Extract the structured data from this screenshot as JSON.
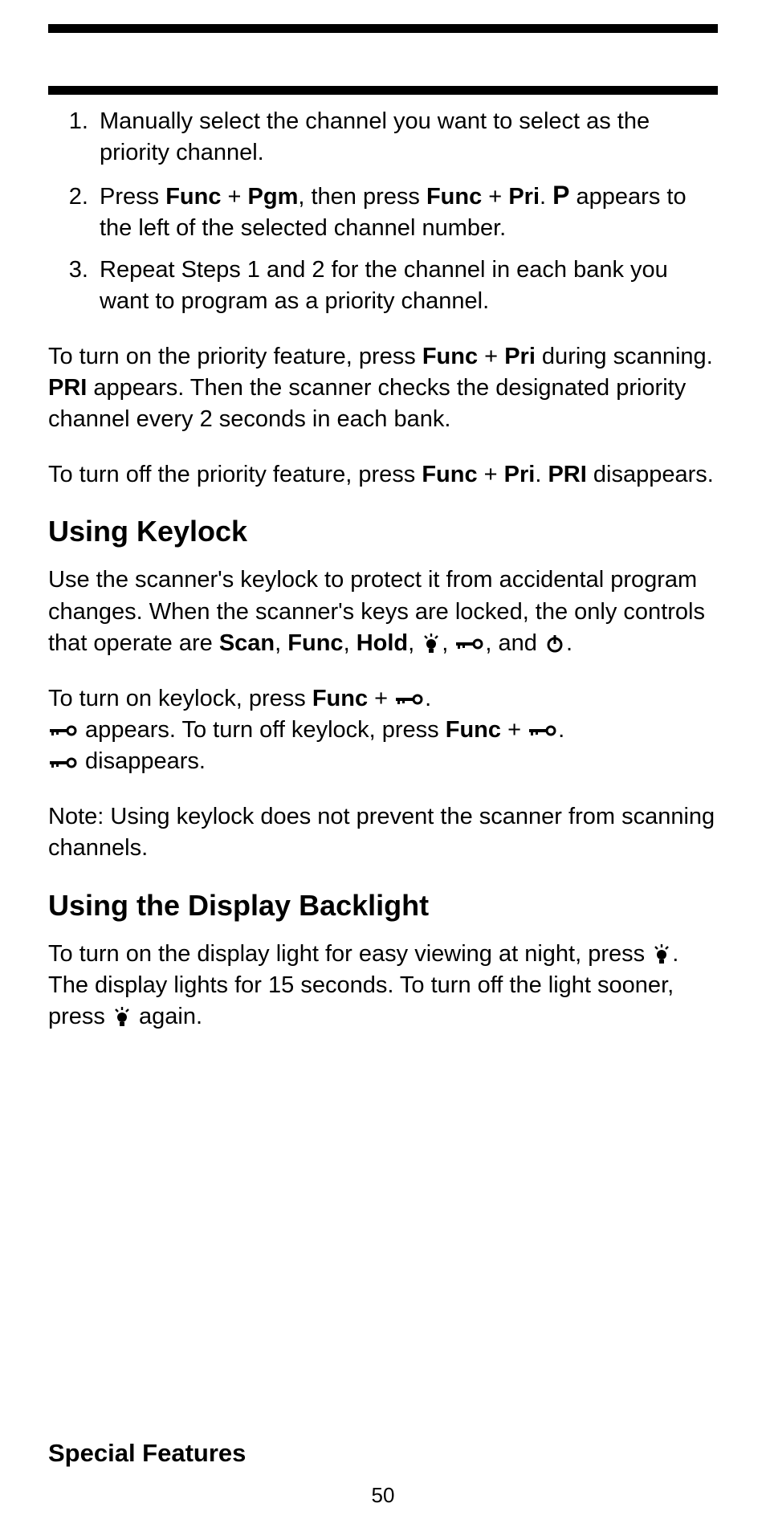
{
  "steps": [
    {
      "num": "1.",
      "text": "Manually select the channel you want to select as the priority channel."
    },
    {
      "num": "2.",
      "prefix": "Press ",
      "b1": "Func",
      "plus1": " + ",
      "b2": "Pgm",
      "mid": ", then press ",
      "b3": "Func",
      "plus2": " + ",
      "b4": "Pri",
      "dot": ". ",
      "pchar": "P",
      "suffix": " appears to the left of the selected channel number."
    },
    {
      "num": "3.",
      "text": "Repeat Steps 1 and 2 for the channel in each bank you want to program as a priority channel."
    }
  ],
  "para_on": {
    "t1": "To turn on the priority feature, press ",
    "b1": "Func",
    "plus": " + ",
    "b2": "Pri",
    "t2": " during scanning. ",
    "b3": "PRI",
    "t3": " appears. Then the scanner checks the designated priority channel every 2 seconds in each bank."
  },
  "para_off": {
    "t1": "To turn off the priority feature, press ",
    "b1": "Func",
    "plus": " + ",
    "b2": "Pri",
    "dot": ". ",
    "b3": "PRI",
    "t2": " disappears."
  },
  "sec_keylock": "Using Keylock",
  "keylock_p1": {
    "t1": "Use the scanner's keylock to protect it from accidental program changes. When the scanner's keys are locked, the only controls that operate are ",
    "b1": "Scan",
    "c1": ", ",
    "b2": "Func",
    "c2": ", ",
    "b3": "Hold",
    "c3": ", ",
    "c4": ", ",
    "c5": ", and ",
    "c6": "."
  },
  "keylock_p2": {
    "t1": "To turn on keylock, press ",
    "b1": "Func",
    "plus1": " + ",
    "dot1": ". ",
    "t2": " appears. To turn off keylock, press ",
    "b2": "Func",
    "plus2": " + ",
    "dot2": ". ",
    "t3": " disappears."
  },
  "keylock_note": "Note: Using keylock does not prevent the scanner from scanning channels.",
  "sec_backlight": "Using the Display Backlight",
  "backlight_p": {
    "t1": "To turn on the display light for easy viewing at night, press ",
    "t2": ". The display lights for 15 seconds. To turn off the light sooner, press ",
    "t3": " again."
  },
  "footer_title": "Special Features",
  "page_number": "50"
}
